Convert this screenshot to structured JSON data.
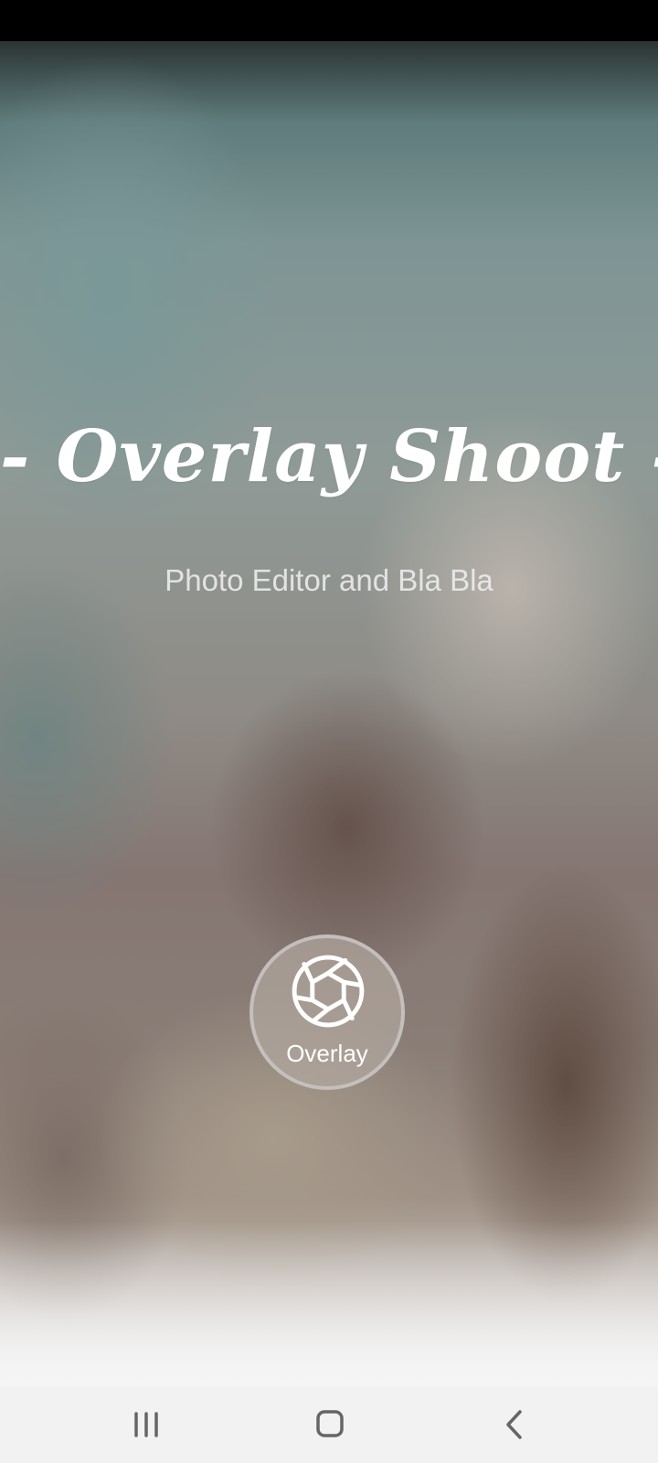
{
  "app": {
    "title": "- Overlay Shoot -",
    "subtitle": "Photo Editor and Bla Bla"
  },
  "overlay_button": {
    "label": "Overlay",
    "icon": "camera-aperture-icon"
  },
  "navigation_bar": {
    "recents_icon": "recent-apps-icon",
    "home_icon": "home-icon",
    "back_icon": "back-icon"
  },
  "colors": {
    "title_text": "#ffffff",
    "subtitle_text": "#eeeeee",
    "nav_bar_background": "#f2f2f2",
    "nav_icon": "#666666",
    "status_bar": "#000000"
  }
}
